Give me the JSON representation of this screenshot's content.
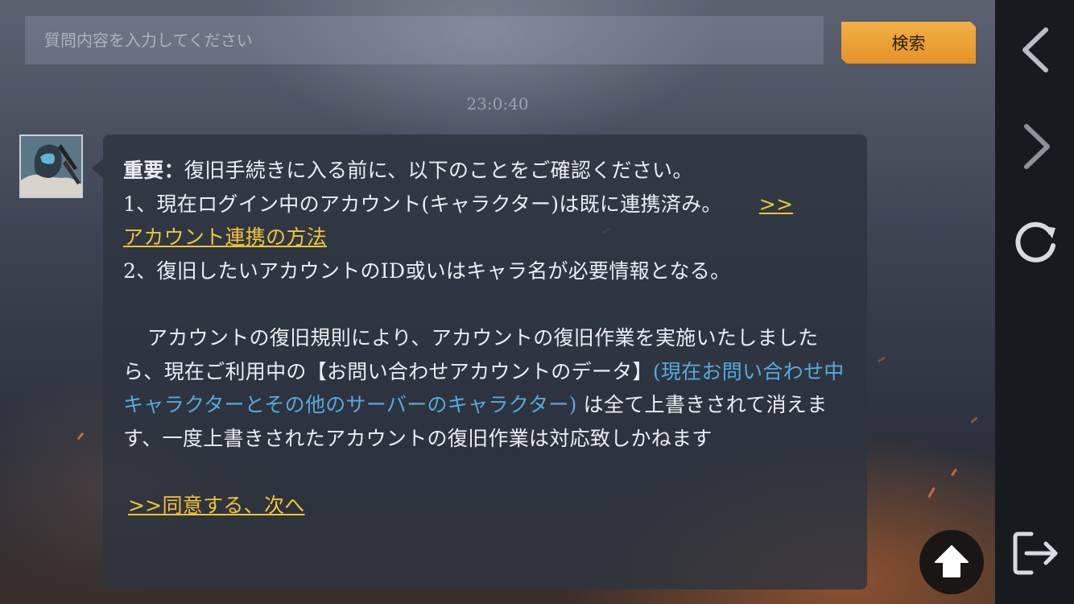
{
  "search": {
    "placeholder": "質問内容を入力してください",
    "value": "",
    "button_label": "検索"
  },
  "chat": {
    "timestamp": "23:0:40",
    "message": {
      "important_label": "重要：",
      "intro": "復旧手続きに入る前に、以下のことをご確認ください。",
      "item1": "1、現在ログイン中のアカウント(キャラクター)は既に連携済み。",
      "item1_link_marker": ">>",
      "item1_link_text": "アカウント連携の方法",
      "item2": "2、復旧したいアカウントのID或いはキャラ名が必要情報となる。",
      "para_start": "アカウントの復旧規則により、アカウントの復旧作業を実施いたしましたら、現在ご利用中の【お問い合わせアカウントのデータ】",
      "para_highlight": "(現在お問い合わせ中キャラクターとその他のサーバーのキャラクター)",
      "para_end": "は全て上書きされて消えます、一度上書きされたアカウントの復旧作業は対応致しかねます",
      "agree_link": ">>同意する、次へ"
    }
  },
  "sidebar": {
    "items": [
      {
        "icon": "chevron-left-icon"
      },
      {
        "icon": "chevron-right-icon"
      },
      {
        "icon": "refresh-icon"
      },
      {
        "icon": "exit-icon"
      }
    ]
  },
  "colors": {
    "accent_orange": "#e8a132",
    "link_yellow": "#f2c33a",
    "highlight_blue": "#57a9de"
  }
}
